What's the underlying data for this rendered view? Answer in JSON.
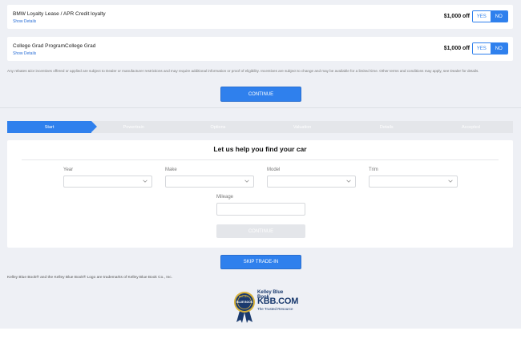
{
  "offers": [
    {
      "name": "BMW Loyalty Lease / APR Credit loyalty",
      "details": "Show Details",
      "amount": "$1,000 off",
      "yes": "YES",
      "no": "NO"
    },
    {
      "name": "College Grad ProgramCollege Grad",
      "details": "Show Details",
      "amount": "$1,000 off",
      "yes": "YES",
      "no": "NO"
    }
  ],
  "disclaimer": "Any rebates &/or incentives offered or applied are subject to Dealer or manufacturer restrictions and may require additional information or proof of eligibility. Incentives are subject to change and may be available for a limited time. Other terms and conditions may apply, see Dealer for details.",
  "continue_label": "CONTINUE",
  "steps": [
    "Start",
    "Powertrain",
    "Options",
    "Valuation",
    "Details",
    "Accepted"
  ],
  "tradein": {
    "title": "Let us help you find your car",
    "labels": {
      "year": "Year",
      "make": "Make",
      "model": "Model",
      "trim": "Trim",
      "mileage": "Mileage"
    },
    "continue_label": "CONTINUE"
  },
  "skip_label": "SKIP TRADE-IN",
  "trademark": "Kelley Blue Book® and the Kelley Blue Book® Logo are trademarks of Kelley Blue Book Co., Inc.",
  "kbb_logo": {
    "line1": "Kelley Blue Book",
    "line2": "KBB.COM",
    "line3": "The Trusted Resource",
    "seal_top": "KELLEY",
    "seal_mid": "BLUE BOOK"
  },
  "colors": {
    "accent": "#2f80ed",
    "step_inactive": "#e4e6ea"
  }
}
